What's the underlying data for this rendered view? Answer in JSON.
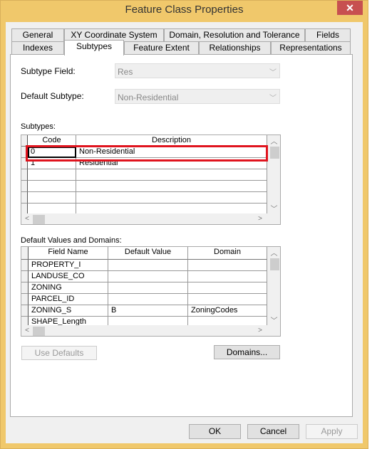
{
  "window": {
    "title": "Feature Class Properties",
    "close_label": "✕",
    "border_color": "#F0C86B",
    "close_color": "#C75050"
  },
  "tabs": {
    "row1": [
      "General",
      "XY Coordinate System",
      "Domain, Resolution and Tolerance",
      "Fields"
    ],
    "row2": [
      "Indexes",
      "Subtypes",
      "Feature Extent",
      "Relationships",
      "Representations"
    ],
    "selected": "Subtypes"
  },
  "subtype_field": {
    "label": "Subtype Field:",
    "value": "Res"
  },
  "default_subtype": {
    "label": "Default Subtype:",
    "value": "Non-Residential"
  },
  "subtypes": {
    "label": "Subtypes:",
    "columns": [
      "Code",
      "Description"
    ],
    "rows": [
      [
        "0",
        "Non-Residential"
      ],
      [
        "1",
        "Residential"
      ],
      [
        "",
        ""
      ],
      [
        "",
        ""
      ],
      [
        "",
        ""
      ],
      [
        "",
        ""
      ]
    ],
    "highlight_color": "#E0141E"
  },
  "defaults": {
    "label": "Default Values and Domains:",
    "columns": [
      "Field Name",
      "Default Value",
      "Domain"
    ],
    "rows": [
      [
        "PROPERTY_I",
        "",
        ""
      ],
      [
        "LANDUSE_CO",
        "",
        ""
      ],
      [
        "ZONING",
        "",
        ""
      ],
      [
        "PARCEL_ID",
        "",
        ""
      ],
      [
        "ZONING_S",
        "B",
        "ZoningCodes"
      ],
      [
        "SHAPE_Length",
        "",
        ""
      ]
    ]
  },
  "buttons": {
    "use_defaults": "Use Defaults",
    "domains": "Domains...",
    "ok": "OK",
    "cancel": "Cancel",
    "apply": "Apply"
  }
}
